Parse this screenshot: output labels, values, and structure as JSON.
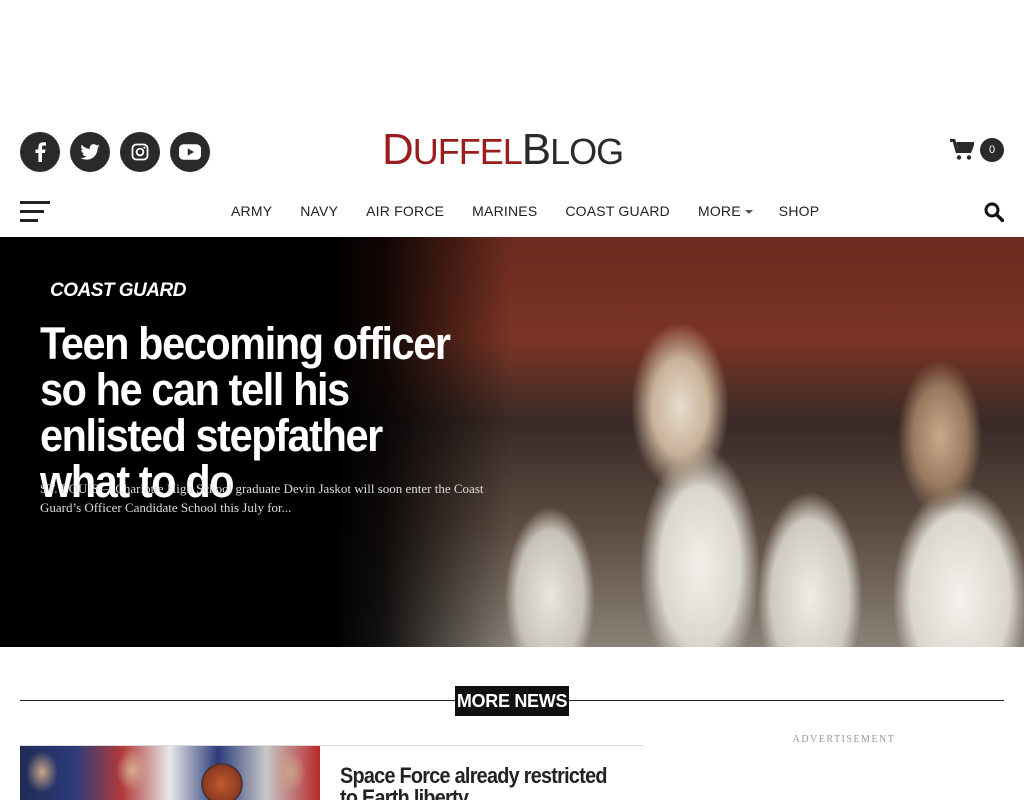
{
  "logo": {
    "duffel_first": "D",
    "duffel_rest": "UFFEL",
    "blog_first": "B",
    "blog_rest": "LOG"
  },
  "social": [
    "facebook-icon",
    "twitter-icon",
    "instagram-icon",
    "youtube-icon"
  ],
  "cart": {
    "count": "0"
  },
  "nav": {
    "items": [
      "ARMY",
      "NAVY",
      "AIR FORCE",
      "MARINES",
      "COAST GUARD",
      "MORE",
      "SHOP"
    ]
  },
  "hero": {
    "category": "COAST GUARD",
    "headline": "Teen becoming officer so he can tell his enlisted stepfather what to do",
    "excerpt": "ST. LOUIS— Charlotte High School graduate Devin Jaskot will soon enter the Coast Guard’s Officer Candidate School this July for..."
  },
  "more_news": {
    "label": "MORE NEWS"
  },
  "stories": [
    {
      "title": "Space Force already restricted to Earth liberty"
    }
  ],
  "advertisement": {
    "label": "ADVERTISEMENT"
  },
  "colors": {
    "brand_red": "#9b1c1c",
    "dark": "#2a2a2a"
  }
}
